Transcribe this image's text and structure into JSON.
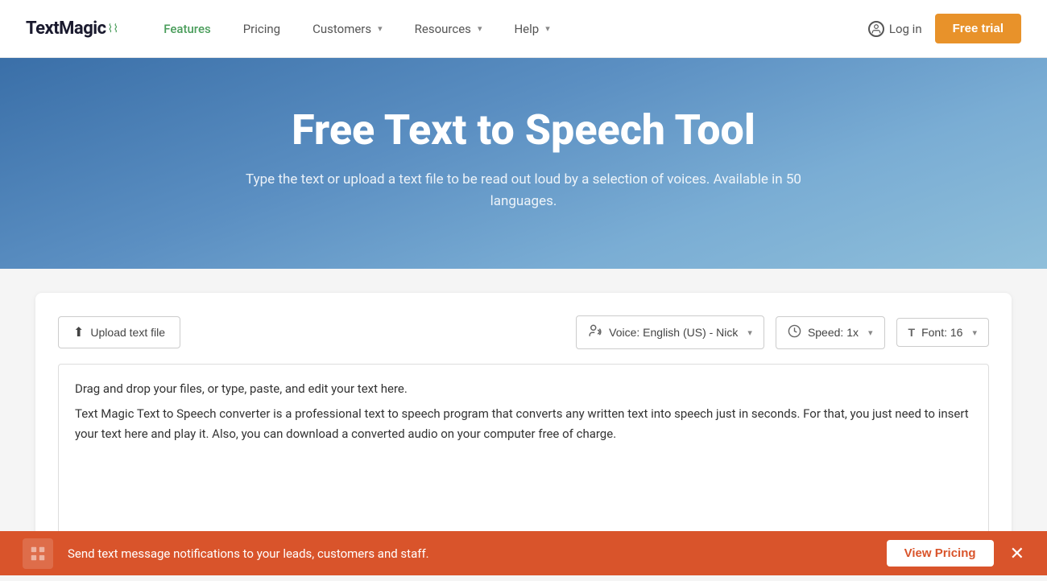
{
  "brand": {
    "name": "TextMagic",
    "logo_signal": "≋"
  },
  "navbar": {
    "links": [
      {
        "label": "Features",
        "active": true
      },
      {
        "label": "Pricing",
        "active": false
      },
      {
        "label": "Customers",
        "active": false,
        "dropdown": true
      },
      {
        "label": "Resources",
        "active": false,
        "dropdown": true
      },
      {
        "label": "Help",
        "active": false,
        "dropdown": true
      }
    ],
    "login_label": "Log in",
    "free_trial_label": "Free trial"
  },
  "hero": {
    "title": "Free Text to Speech Tool",
    "subtitle": "Type the text or upload a text file to be read out loud by a selection of voices. Available in 50 languages."
  },
  "toolbar": {
    "upload_label": "Upload text file",
    "voice_label": "Voice: English (US) - Nick",
    "speed_label": "Speed: 1x",
    "font_label": "Font: 16"
  },
  "textarea": {
    "content_line1": "Drag and drop your files, or type, paste, and edit your text here.",
    "content_line2": "Text Magic Text to Speech converter is a professional text to speech program that converts any written text into speech just in seconds. For that, you just need to insert your text here and play it. Also, you can download a converted audio on your computer free of charge."
  },
  "notification": {
    "message": "Send text message notifications to your leads, customers and staff.",
    "cta_label": "View Pricing"
  }
}
